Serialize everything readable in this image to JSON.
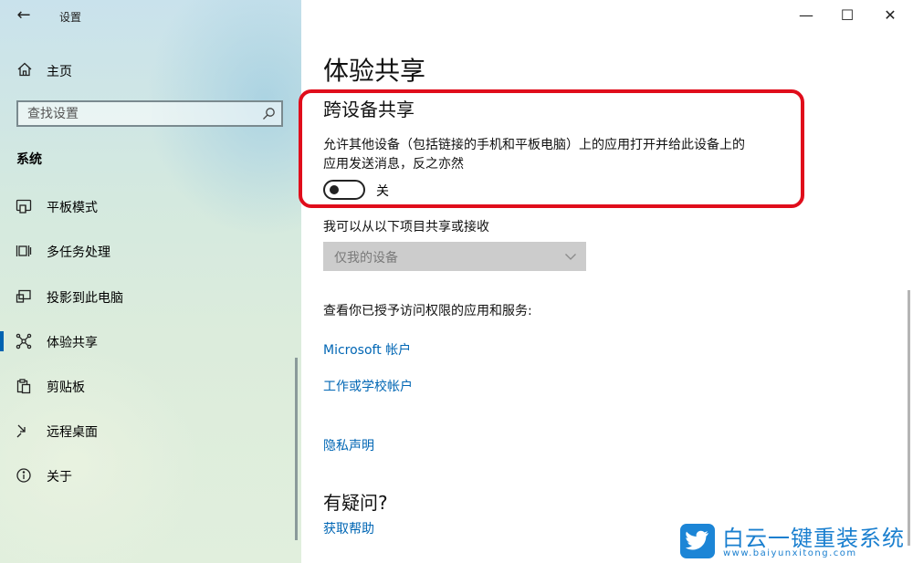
{
  "window": {
    "title": "设置",
    "back_glyph": "←",
    "minimize_glyph": "—",
    "maximize_glyph": "☐",
    "close_glyph": "✕"
  },
  "sidebar": {
    "home_label": "主页",
    "search_placeholder": "查找设置",
    "section_label": "系统",
    "items": [
      {
        "label": "平板模式",
        "icon": "tablet-mode-icon"
      },
      {
        "label": "多任务处理",
        "icon": "multitasking-icon"
      },
      {
        "label": "投影到此电脑",
        "icon": "project-icon"
      },
      {
        "label": "体验共享",
        "icon": "shared-experiences-icon",
        "selected": true
      },
      {
        "label": "剪贴板",
        "icon": "clipboard-icon"
      },
      {
        "label": "远程桌面",
        "icon": "remote-desktop-icon"
      },
      {
        "label": "关于",
        "icon": "info-icon"
      }
    ]
  },
  "main": {
    "page_title": "体验共享",
    "cross_device": {
      "heading": "跨设备共享",
      "description": "允许其他设备（包括链接的手机和平板电脑）上的应用打开并给此设备上的应用发送消息，反之亦然",
      "toggle_state": "关"
    },
    "share_from_label": "我可以从以下项目共享或接收",
    "dropdown_value": "仅我的设备",
    "permissions_label": "查看你已授予访问权限的应用和服务:",
    "links": {
      "microsoft_account": "Microsoft 帐户",
      "work_school_account": "工作或学校帐户",
      "privacy": "隐私声明"
    },
    "help": {
      "heading": "有疑问?",
      "get_help": "获取帮助"
    }
  },
  "watermark": {
    "title": "白云一键重装系统",
    "url": "www.baiyunxitong.com"
  },
  "colors": {
    "accent": "#0063b1",
    "link": "#0066b4",
    "highlight": "#e00d1b",
    "dropdown_bg": "#cccccc"
  }
}
